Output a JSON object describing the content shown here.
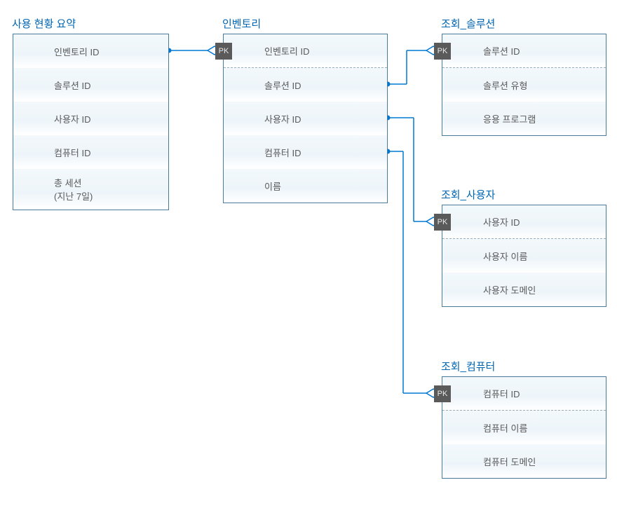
{
  "colors": {
    "accent": "#0066b3",
    "border": "#4a7a9a",
    "rowFill": "#eef6fb",
    "dot": "#0078d4",
    "pkBg": "#5a5a5a"
  },
  "entities": {
    "usage": {
      "title": "사용 현황 요약",
      "rows": [
        "인벤토리 ID",
        "솔루션 ID",
        "사용자 ID",
        "컴퓨터 ID",
        "총 세션\n(지난 7일)"
      ]
    },
    "inventory": {
      "title": "인벤토리",
      "pkLabel": "PK",
      "rows": [
        "인벤토리 ID",
        "솔루션 ID",
        "사용자 ID",
        "컴퓨터 ID",
        "이름"
      ]
    },
    "solution": {
      "title": "조회_솔루션",
      "pkLabel": "PK",
      "rows": [
        "솔루션 ID",
        "솔루션 유형",
        "응용 프로그램"
      ]
    },
    "user": {
      "title": "조회_사용자",
      "pkLabel": "PK",
      "rows": [
        "사용자 ID",
        "사용자 이름",
        "사용자 도메인"
      ]
    },
    "computer": {
      "title": "조회_컴퓨터",
      "pkLabel": "PK",
      "rows": [
        "컴퓨터 ID",
        "컴퓨터 이름",
        "컴퓨터 도메인"
      ]
    }
  },
  "relationships": [
    {
      "from": "usage.인벤토리 ID",
      "to": "inventory.인벤토리 ID",
      "type": "fk-pk"
    },
    {
      "from": "inventory.솔루션 ID",
      "to": "solution.솔루션 ID",
      "type": "fk-pk"
    },
    {
      "from": "inventory.사용자 ID",
      "to": "user.사용자 ID",
      "type": "fk-pk"
    },
    {
      "from": "inventory.컴퓨터 ID",
      "to": "computer.컴퓨터 ID",
      "type": "fk-pk"
    }
  ]
}
